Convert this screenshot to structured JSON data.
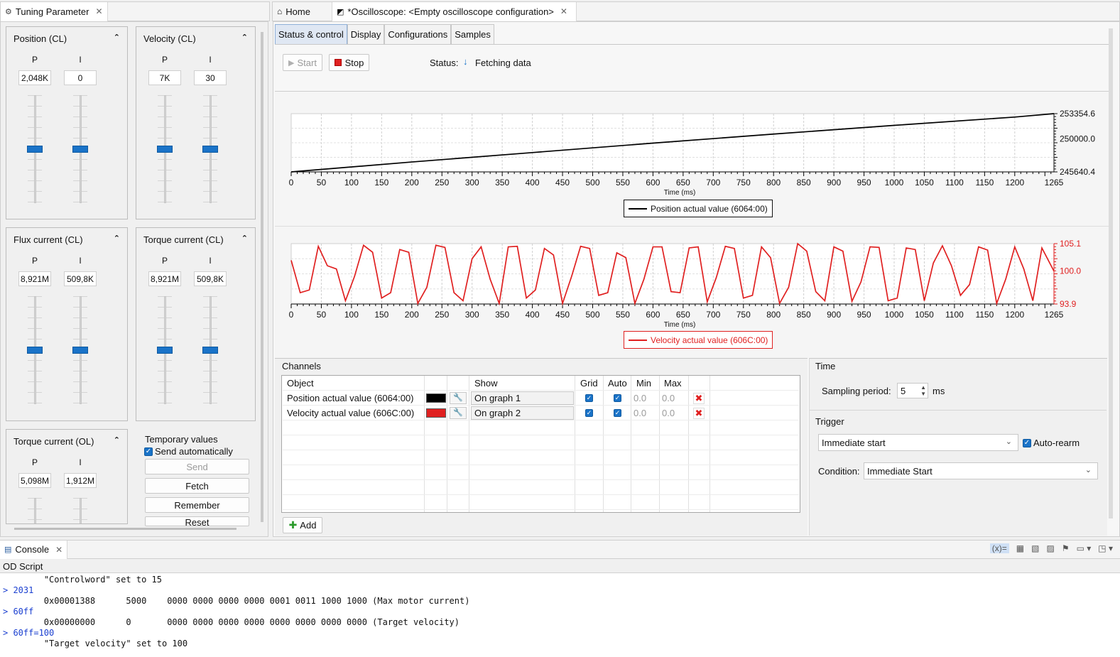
{
  "left_tab": {
    "title": "Tuning Parameter"
  },
  "panels": [
    {
      "id": "position",
      "title": "Position (CL)",
      "p_label": "P",
      "i_label": "I",
      "p_value": "2,048K",
      "i_value": "0"
    },
    {
      "id": "velocity",
      "title": "Velocity (CL)",
      "p_label": "P",
      "i_label": "I",
      "p_value": "7K",
      "i_value": "30"
    },
    {
      "id": "flux",
      "title": "Flux current (CL)",
      "p_label": "P",
      "i_label": "I",
      "p_value": "8,921M",
      "i_value": "509,8K"
    },
    {
      "id": "torque_cl",
      "title": "Torque current (CL)",
      "p_label": "P",
      "i_label": "I",
      "p_value": "8,921M",
      "i_value": "509,8K"
    },
    {
      "id": "torque_ol",
      "title": "Torque current (OL)",
      "p_label": "P",
      "i_label": "I",
      "p_value": "5,098M",
      "i_value": "1,912M"
    }
  ],
  "temporary": {
    "title": "Temporary values",
    "send_auto": "Send automatically",
    "send": "Send",
    "fetch": "Fetch",
    "remember": "Remember",
    "reset": "Reset"
  },
  "editor_tabs": {
    "home": "Home",
    "osc": "*Oscilloscope: <Empty oscilloscope configuration>"
  },
  "subtabs": [
    "Status & control",
    "Display",
    "Configurations",
    "Samples"
  ],
  "controls": {
    "start": "Start",
    "stop": "Stop",
    "status_label": "Status:",
    "status_value": "Fetching data"
  },
  "chart_data": [
    {
      "type": "line",
      "xlabel": "Time (ms)",
      "xticks": [
        "0",
        "50",
        "100",
        "150",
        "200",
        "250",
        "300",
        "350",
        "400",
        "450",
        "500",
        "550",
        "600",
        "650",
        "700",
        "750",
        "800",
        "850",
        "900",
        "950",
        "1000",
        "1050",
        "1100",
        "1150",
        "1200",
        "1265"
      ],
      "xlim": [
        0,
        1265
      ],
      "ylim": [
        245640.4,
        253354.6
      ],
      "yticks": [
        "253354.6",
        "250000.0",
        "245640.4"
      ],
      "grid": true,
      "legend": "bottom-center",
      "series": [
        {
          "name": "Position actual value (6064:00)",
          "color": "#000000",
          "x": [
            0,
            200,
            400,
            600,
            800,
            1000,
            1200,
            1265
          ],
          "y": [
            245640.4,
            246950,
            248200,
            249450,
            250650,
            251800,
            252900,
            253354.6
          ]
        }
      ]
    },
    {
      "type": "line",
      "xlabel": "Time (ms)",
      "xticks": [
        "0",
        "50",
        "100",
        "150",
        "200",
        "250",
        "300",
        "350",
        "400",
        "450",
        "500",
        "550",
        "600",
        "650",
        "700",
        "750",
        "800",
        "850",
        "900",
        "950",
        "1000",
        "1050",
        "1100",
        "1150",
        "1200",
        "1265"
      ],
      "xlim": [
        0,
        1265
      ],
      "ylim": [
        93.9,
        105.1
      ],
      "yticks": [
        "105.1",
        "100.0",
        "93.9"
      ],
      "grid": true,
      "legend": "bottom-center",
      "series": [
        {
          "name": "Velocity actual value (606C:00)",
          "color": "#e02020",
          "x": [
            0,
            15,
            30,
            45,
            60,
            75,
            90,
            105,
            120,
            135,
            150,
            165,
            180,
            195,
            210,
            225,
            240,
            255,
            270,
            285,
            300,
            315,
            330,
            345,
            360,
            375,
            390,
            405,
            420,
            435,
            450,
            465,
            480,
            495,
            510,
            525,
            540,
            555,
            570,
            585,
            600,
            615,
            630,
            645,
            660,
            675,
            690,
            705,
            720,
            735,
            750,
            765,
            780,
            795,
            810,
            825,
            840,
            855,
            870,
            885,
            900,
            915,
            930,
            945,
            960,
            975,
            990,
            1005,
            1020,
            1035,
            1050,
            1065,
            1080,
            1095,
            1110,
            1125,
            1140,
            1155,
            1170,
            1185,
            1200,
            1215,
            1230,
            1245,
            1265
          ],
          "y": [
            102,
            96,
            96.5,
            104.6,
            101,
            100.4,
            94.5,
            99,
            104.8,
            103.5,
            95,
            96,
            104,
            103.5,
            94,
            97,
            104.8,
            104.4,
            96,
            94.5,
            102.3,
            104.5,
            98.5,
            94,
            104.5,
            104.6,
            95,
            96.5,
            104.2,
            103,
            94,
            99,
            104.6,
            104.2,
            95.5,
            96,
            103.4,
            102.5,
            94,
            98.5,
            104.5,
            104.5,
            96.2,
            96,
            104.3,
            104.5,
            94.3,
            98.8,
            104.6,
            104.2,
            95,
            95.5,
            104.5,
            102.5,
            94,
            97,
            105.1,
            103.7,
            96.2,
            94.5,
            104.5,
            103.7,
            94.4,
            98,
            104.5,
            104.4,
            94.5,
            95,
            104.3,
            104,
            94.5,
            101.5,
            104.7,
            101,
            95.5,
            97.5,
            104.5,
            103.9,
            94,
            98.5,
            104.5,
            100.4,
            94.5,
            104.3,
            100
          ]
        }
      ]
    }
  ],
  "channels": {
    "title": "Channels",
    "headers": [
      "Object",
      "",
      "Show",
      "Grid",
      "Auto",
      "Min",
      "Max"
    ],
    "rows": [
      {
        "object": "Position actual value (6064:00)",
        "color": "#000000",
        "show": "On graph 1",
        "min": "0.0",
        "max": "0.0"
      },
      {
        "object": "Velocity actual value (606C:00)",
        "color": "#e02020",
        "show": "On graph 2",
        "min": "0.0",
        "max": "0.0"
      }
    ],
    "add": "Add"
  },
  "time": {
    "title": "Time",
    "sampling_label": "Sampling period:",
    "sampling_value": "5",
    "unit": "ms"
  },
  "trigger": {
    "title": "Trigger",
    "mode": "Immediate start",
    "auto_rearm": "Auto-rearm",
    "condition_label": "Condition:",
    "condition": "Immediate Start"
  },
  "console": {
    "title": "Console",
    "subtitle": "OD Script",
    "lines": [
      {
        "prompt": false,
        "text": "        \"Controlword\" set to 15"
      },
      {
        "prompt": true,
        "text": "2031"
      },
      {
        "prompt": false,
        "text": "        0x00001388      5000    0000 0000 0000 0000 0001 0011 1000 1000 (Max motor current)"
      },
      {
        "prompt": true,
        "text": "60ff"
      },
      {
        "prompt": false,
        "text": "        0x00000000      0       0000 0000 0000 0000 0000 0000 0000 0000 (Target velocity)"
      },
      {
        "prompt": true,
        "text": "60ff=100"
      },
      {
        "prompt": false,
        "text": "        \"Target velocity\" set to 100"
      }
    ]
  }
}
